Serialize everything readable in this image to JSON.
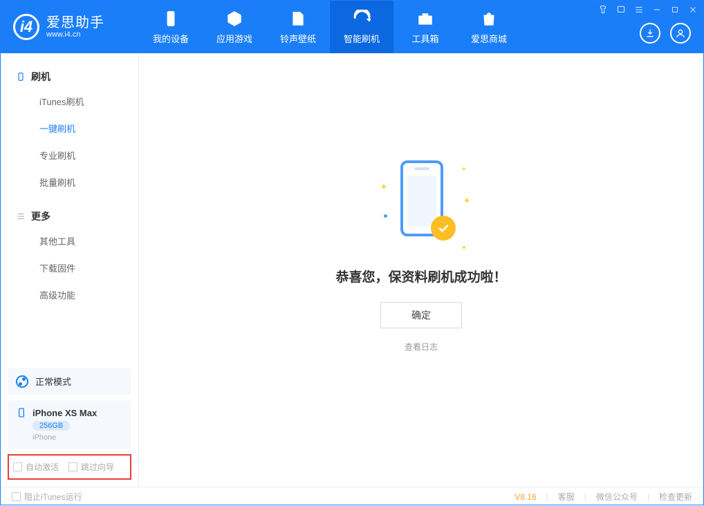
{
  "app": {
    "name_cn": "爱思助手",
    "url": "www.i4.cn"
  },
  "nav": {
    "items": [
      {
        "label": "我的设备"
      },
      {
        "label": "应用游戏"
      },
      {
        "label": "铃声壁纸"
      },
      {
        "label": "智能刷机"
      },
      {
        "label": "工具箱"
      },
      {
        "label": "爱思商城"
      }
    ],
    "active_index": 3
  },
  "sidebar": {
    "groups": [
      {
        "title": "刷机",
        "items": [
          {
            "label": "iTunes刷机"
          },
          {
            "label": "一键刷机"
          },
          {
            "label": "专业刷机"
          },
          {
            "label": "批量刷机"
          }
        ],
        "active_index": 1
      },
      {
        "title": "更多",
        "items": [
          {
            "label": "其他工具"
          },
          {
            "label": "下载固件"
          },
          {
            "label": "高级功能"
          }
        ]
      }
    ],
    "mode_label": "正常模式",
    "device": {
      "name": "iPhone XS Max",
      "storage": "256GB",
      "model": "iPhone"
    },
    "checks": {
      "auto_activate": "自动激活",
      "skip_guide": "跳过向导"
    }
  },
  "main": {
    "success_text": "恭喜您，保资料刷机成功啦！",
    "ok_label": "确定",
    "log_link": "查看日志"
  },
  "footer": {
    "block_itunes": "阻止iTunes运行",
    "version": "V8.16",
    "links": {
      "support": "客服",
      "wechat": "微信公众号",
      "update": "检查更新"
    }
  }
}
